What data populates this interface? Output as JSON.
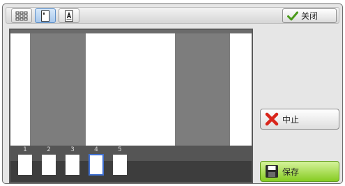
{
  "toolbar": {
    "views": [
      {
        "name": "thumbnail-grid-view",
        "icon": "grid-icon",
        "active": false
      },
      {
        "name": "single-page-view",
        "icon": "page-icon",
        "active": true
      },
      {
        "name": "text-page-view",
        "icon": "text-page-icon",
        "active": false
      }
    ],
    "close_label": "关闭",
    "close_icon": "checkmark-icon"
  },
  "preview": {
    "pages": [
      {
        "number": "1",
        "selected": false
      },
      {
        "number": "2",
        "selected": false
      },
      {
        "number": "3",
        "selected": false
      },
      {
        "number": "4",
        "selected": true
      },
      {
        "number": "5",
        "selected": false
      }
    ]
  },
  "actions": {
    "stop_label": "中止",
    "stop_icon": "red-x-icon",
    "save_label": "保存",
    "save_icon": "floppy-disk-icon"
  },
  "colors": {
    "selected_border": "#3f6fd1",
    "save_green": "#86cc22",
    "stop_red": "#d9261c",
    "check_green": "#4a9a1a"
  }
}
